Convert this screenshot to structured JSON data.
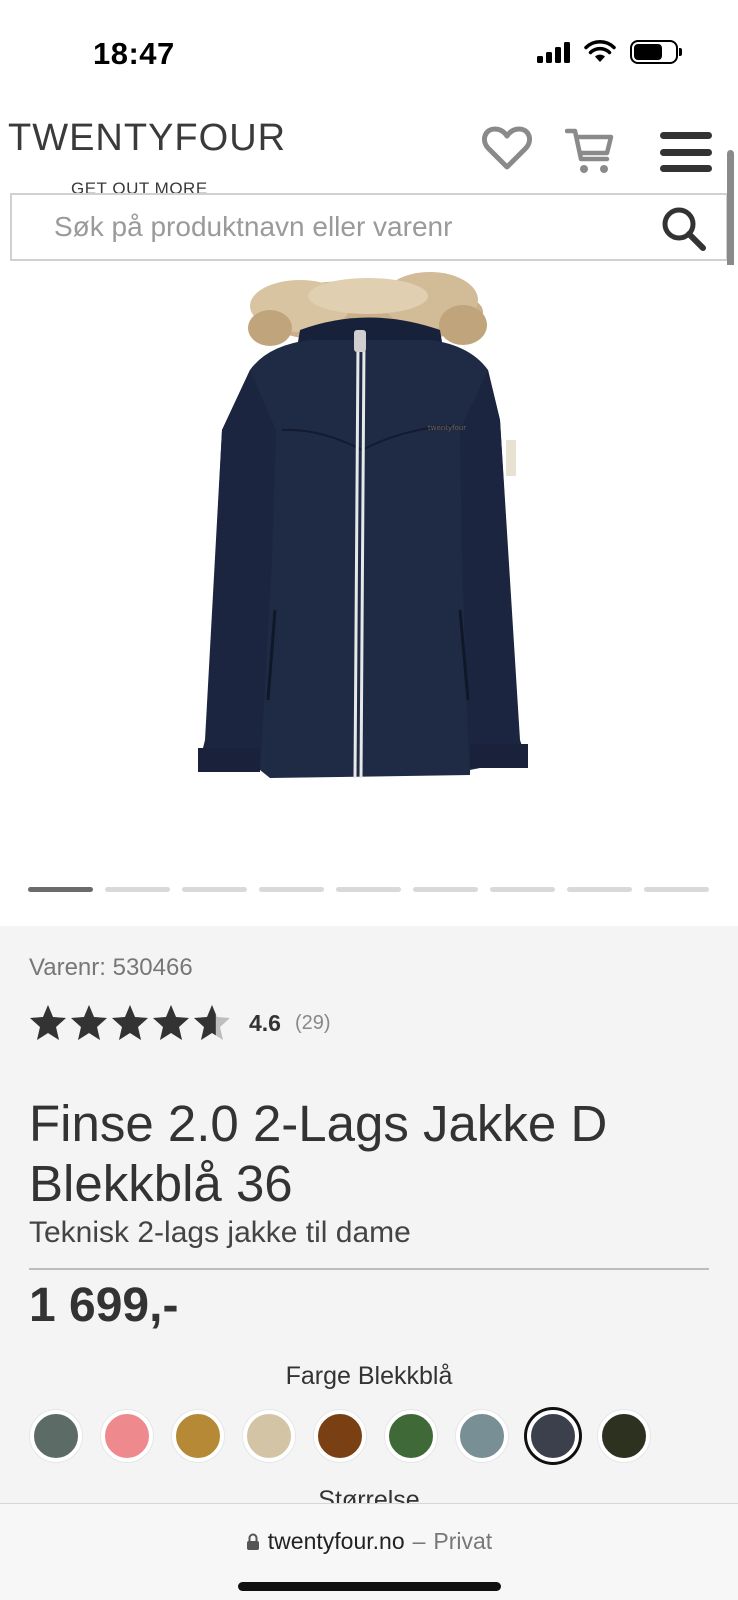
{
  "status_bar": {
    "time": "18:47"
  },
  "header": {
    "logo_text": "TWENTYFOUR",
    "logo_tagline": "GET OUT MORE",
    "icons": [
      "heart-icon",
      "cart-icon",
      "menu-icon"
    ]
  },
  "search": {
    "placeholder": "Søk på produktnavn eller varenr"
  },
  "gallery": {
    "image_count": 9,
    "active_index": 0
  },
  "product": {
    "sku_label": "Varenr:",
    "sku_value": "530466",
    "rating_value": "4.6",
    "rating_count": "(29)",
    "rating_stars": 4.6,
    "title": "Finse 2.0 2-Lags Jakke D Blekkblå 36",
    "subtitle": "Teknisk 2-lags jakke til dame",
    "price": "1 699,-",
    "color_label": "Farge Blekkblå",
    "size_label": "Størrelse",
    "swatches": [
      "#5d6b66",
      "#ee8a8d",
      "#b58935",
      "#d4c4a6",
      "#7a3f12",
      "#3f6a38",
      "#778f95",
      "#3c3f4c",
      "#2d3120"
    ],
    "selected_swatch": 7
  },
  "browser": {
    "domain": "twentyfour.no",
    "separator": "–",
    "mode": "Privat"
  },
  "colors": {
    "navy_jacket": "#1f2a44",
    "text": "#333333",
    "panel_bg": "#f4f4f4"
  }
}
